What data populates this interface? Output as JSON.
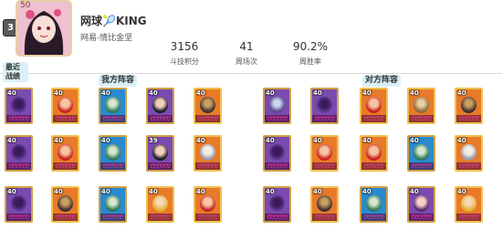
{
  "player": {
    "rank": "3",
    "avatar_level": "50",
    "name": "网球🎾KING",
    "server": "网易-情比金坚"
  },
  "stats": [
    {
      "value": "3156",
      "label": "斗技积分"
    },
    {
      "value": "41",
      "label": "周场次"
    },
    {
      "value": "90.2%",
      "label": "周胜率"
    }
  ],
  "sections": {
    "recent_battles": "最近战绩",
    "my_lineup": "我方阵容",
    "enemy_lineup": "对方阵容"
  },
  "stars_text": "ღღღღღღ",
  "battles": [
    {
      "my": [
        {
          "level": "40",
          "portrait": "purple-hood",
          "frame": "purple"
        },
        {
          "level": "40",
          "portrait": "red-hair",
          "frame": "orange"
        },
        {
          "level": "40",
          "portrait": "green-hair",
          "frame": "blue"
        },
        {
          "level": "40",
          "portrait": "black-hair",
          "frame": "purple"
        },
        {
          "level": "40",
          "portrait": "armored-general",
          "frame": "orange"
        }
      ],
      "enemy": [
        {
          "level": "40",
          "portrait": "blue-demon",
          "frame": "purple"
        },
        {
          "level": "40",
          "portrait": "purple-hood",
          "frame": "purple"
        },
        {
          "level": "40",
          "portrait": "red-hair",
          "frame": "orange"
        },
        {
          "level": "40",
          "portrait": "masked-beast",
          "frame": "orange"
        },
        {
          "level": "40",
          "portrait": "armored-general",
          "frame": "orange"
        }
      ]
    },
    {
      "my": [
        {
          "level": "40",
          "portrait": "purple-hood",
          "frame": "purple"
        },
        {
          "level": "40",
          "portrait": "red-hair",
          "frame": "orange"
        },
        {
          "level": "40",
          "portrait": "green-hair",
          "frame": "blue"
        },
        {
          "level": "39",
          "portrait": "dark-hair",
          "frame": "purple"
        },
        {
          "level": "40",
          "portrait": "white-hair",
          "frame": "orange"
        }
      ],
      "enemy": [
        {
          "level": "40",
          "portrait": "purple-hood",
          "frame": "purple"
        },
        {
          "level": "40",
          "portrait": "red-hair",
          "frame": "orange"
        },
        {
          "level": "40",
          "portrait": "red-hair",
          "frame": "orange"
        },
        {
          "level": "40",
          "portrait": "green-hair",
          "frame": "blue"
        },
        {
          "level": "40",
          "portrait": "white-hair",
          "frame": "orange"
        }
      ]
    },
    {
      "my": [
        {
          "level": "40",
          "portrait": "purple-hood",
          "frame": "purple"
        },
        {
          "level": "40",
          "portrait": "armored-general",
          "frame": "orange"
        },
        {
          "level": "40",
          "portrait": "green-hair",
          "frame": "blue"
        },
        {
          "level": "40",
          "portrait": "blond-hair",
          "frame": "orange"
        },
        {
          "level": "40",
          "portrait": "red-hair",
          "frame": "orange"
        }
      ],
      "enemy": [
        {
          "level": "40",
          "portrait": "purple-hood",
          "frame": "purple"
        },
        {
          "level": "40",
          "portrait": "armored-general",
          "frame": "orange"
        },
        {
          "level": "40",
          "portrait": "green-hair",
          "frame": "blue"
        },
        {
          "level": "40",
          "portrait": "pink-hair",
          "frame": "purple"
        },
        {
          "level": "40",
          "portrait": "blond-hair",
          "frame": "orange"
        }
      ]
    }
  ]
}
